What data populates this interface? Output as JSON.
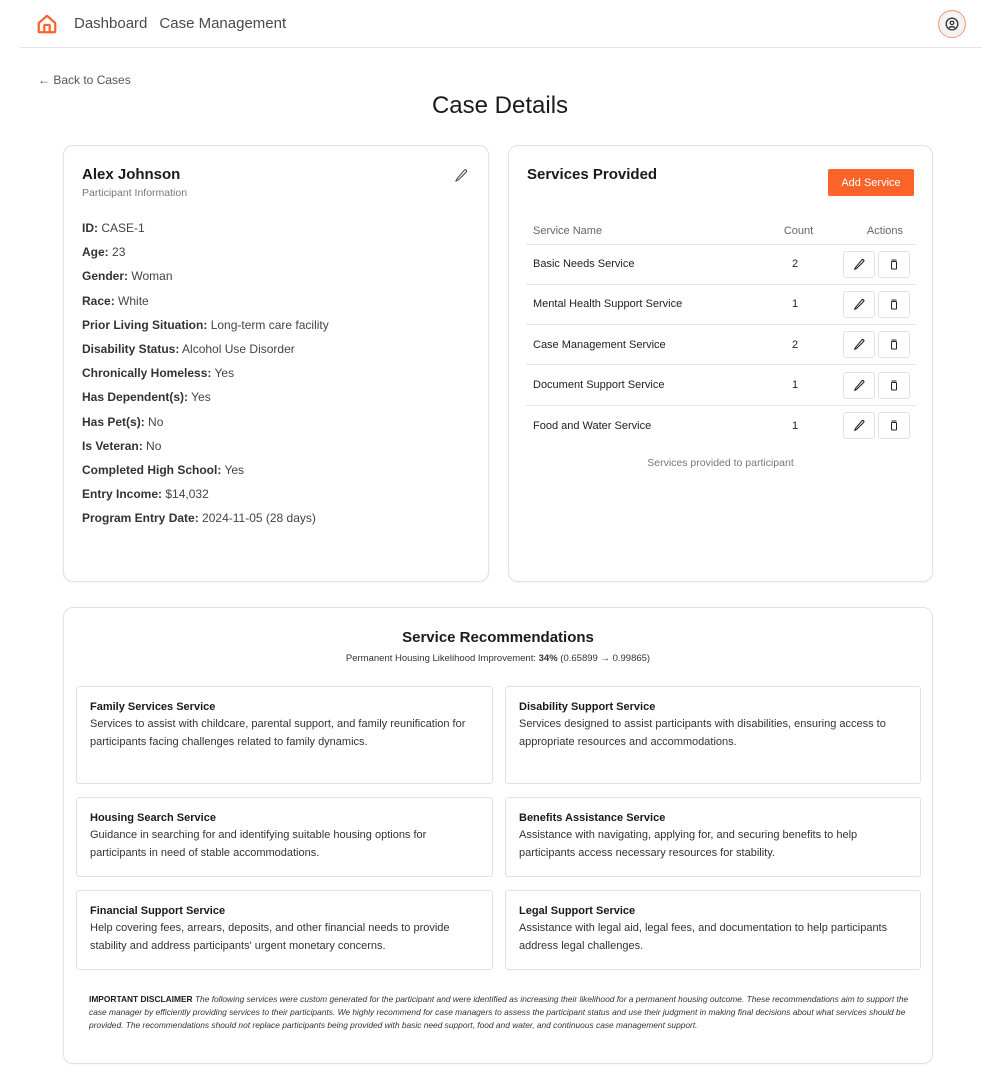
{
  "nav": {
    "home_icon": "home-icon",
    "links": [
      {
        "label": "Dashboard"
      },
      {
        "label": "Case Management"
      }
    ],
    "profile_icon": "user-circle-icon"
  },
  "back_link": "← Back to Cases",
  "page_title": "Case Details",
  "participant": {
    "name": "Alex Johnson",
    "subtitle": "Participant Information",
    "edit_icon": "pencil-icon",
    "fields": [
      {
        "label": "ID:",
        "value": "CASE-1"
      },
      {
        "label": "Age:",
        "value": "23"
      },
      {
        "label": "Gender:",
        "value": "Woman"
      },
      {
        "label": "Race:",
        "value": "White"
      },
      {
        "label": "Prior Living Situation:",
        "value": "Long-term care facility"
      },
      {
        "label": "Disability Status:",
        "value": "Alcohol Use Disorder"
      },
      {
        "label": "Chronically Homeless:",
        "value": "Yes"
      },
      {
        "label": "Has Dependent(s):",
        "value": "Yes"
      },
      {
        "label": "Has Pet(s):",
        "value": "No"
      },
      {
        "label": "Is Veteran:",
        "value": "No"
      },
      {
        "label": "Completed High School:",
        "value": "Yes"
      },
      {
        "label": "Entry Income:",
        "value": "$14,032"
      },
      {
        "label": "Program Entry Date:",
        "value": "2024-11-05 (28 days)"
      }
    ]
  },
  "services": {
    "title": "Services Provided",
    "add_button": "Add Service",
    "columns": [
      "Service Name",
      "Count",
      "Actions"
    ],
    "rows": [
      {
        "name": "Basic Needs Service",
        "count": "2"
      },
      {
        "name": "Mental Health Support Service",
        "count": "1"
      },
      {
        "name": "Case Management Service",
        "count": "2"
      },
      {
        "name": "Document Support Service",
        "count": "1"
      },
      {
        "name": "Food and Water Service",
        "count": "1"
      }
    ],
    "caption": "Services provided to participant"
  },
  "recommendations": {
    "title": "Service Recommendations",
    "improvement_label": "Permanent Housing Likelihood Improvement:",
    "improvement_percent": "34%",
    "improvement_range": "(0.65899 → 0.99865)",
    "items": [
      {
        "title": "Family Services Service",
        "description": "Services to assist with childcare, parental support, and family reunification for participants facing challenges related to family dynamics."
      },
      {
        "title": "Disability Support Service",
        "description": "Services designed to assist participants with disabilities, ensuring access to appropriate resources and accommodations."
      },
      {
        "title": "Housing Search Service",
        "description": "Guidance in searching for and identifying suitable housing options for participants in need of stable accommodations."
      },
      {
        "title": "Benefits Assistance Service",
        "description": "Assistance with navigating, applying for, and securing benefits to help participants access necessary resources for stability."
      },
      {
        "title": "Financial Support Service",
        "description": "Help covering fees, arrears, deposits, and other financial needs to provide stability and address participants' urgent monetary concerns."
      },
      {
        "title": "Legal Support Service",
        "description": "Assistance with legal aid, legal fees, and documentation to help participants address legal challenges."
      }
    ],
    "disclaimer_label": "IMPORTANT DISCLAIMER",
    "disclaimer_text": "The following services were custom generated for the participant and were identified as increasing their likelihood for a permanent housing outcome. These recommendations aim to support the case manager by efficiently providing services to their participants. We highly recommend for case managers to assess the participant status and use their judgment in making final decisions about what services should be provided. The recommendations should not replace participants being provided with basic need support, food and water, and continuous case management support."
  },
  "colors": {
    "accent": "#fb6328",
    "profile_ring": "#f5956a"
  }
}
